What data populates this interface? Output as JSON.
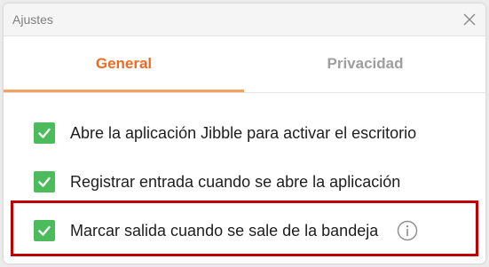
{
  "window": {
    "title": "Ajustes"
  },
  "tabs": [
    {
      "label": "General",
      "active": true
    },
    {
      "label": "Privacidad",
      "active": false
    }
  ],
  "settings": {
    "options": [
      {
        "label": "Abre la aplicación Jibble para activar el escritorio",
        "checked": true
      },
      {
        "label": "Registrar entrada cuando se abre la aplicación",
        "checked": true
      },
      {
        "label": "Marcar salida cuando se sale de la bandeja",
        "checked": true,
        "has_info": true
      }
    ]
  },
  "colors": {
    "accent": "#f26a21",
    "checkbox": "#4cbb5b",
    "highlight": "#c00000"
  },
  "icons": [
    "close-icon",
    "checkmark-icon",
    "info-icon"
  ]
}
